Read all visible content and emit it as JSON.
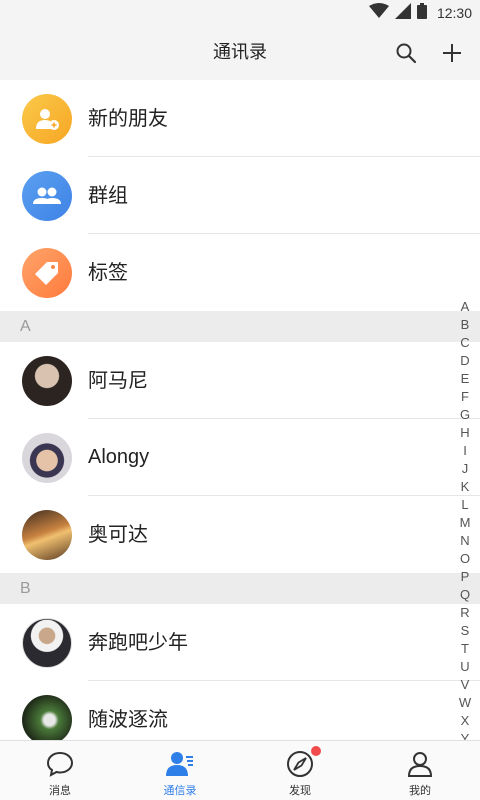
{
  "status_bar": {
    "time": "12:30"
  },
  "top_bar": {
    "title": "通讯录"
  },
  "colors": {
    "accent": "#2f7fe8",
    "new_friends": "#f8b731",
    "groups": "#4a8fea",
    "tags": "#ff8c4b",
    "badge": "#f24b4b"
  },
  "fixed_items": [
    {
      "label": "新的朋友",
      "icon": "add-person-icon"
    },
    {
      "label": "群组",
      "icon": "group-icon"
    },
    {
      "label": "标签",
      "icon": "tag-icon"
    }
  ],
  "sections": [
    {
      "letter": "A",
      "contacts": [
        "阿马尼",
        "Alongy",
        "奥可达"
      ]
    },
    {
      "letter": "B",
      "contacts": [
        "奔跑吧少年",
        "随波逐流"
      ]
    }
  ],
  "index_letters": [
    "A",
    "B",
    "C",
    "D",
    "E",
    "F",
    "G",
    "H",
    "I",
    "J",
    "K",
    "L",
    "M",
    "N",
    "O",
    "P",
    "Q",
    "R",
    "S",
    "T",
    "U",
    "V",
    "W",
    "X",
    "Y"
  ],
  "bottom_nav": [
    {
      "label": "消息",
      "icon": "chat-bubble-icon",
      "active": false
    },
    {
      "label": "通信录",
      "icon": "contacts-icon",
      "active": true
    },
    {
      "label": "发现",
      "icon": "compass-icon",
      "active": false,
      "badge": true
    },
    {
      "label": "我的",
      "icon": "person-icon",
      "active": false
    }
  ]
}
